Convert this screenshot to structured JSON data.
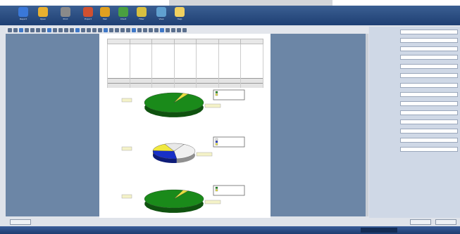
{
  "app": {
    "toolbar_buttons": [
      {
        "label": "Report",
        "icon": "globe-icon",
        "color": "#3a78d8"
      },
      {
        "label": "Open",
        "icon": "open-icon",
        "color": "#e8b030"
      },
      {
        "label": "Print",
        "icon": "printer-icon",
        "color": "#8a8a8a"
      },
      {
        "label": "Export",
        "icon": "export-icon",
        "color": "#d05030"
      },
      {
        "label": "Mail",
        "icon": "mail-icon",
        "color": "#e0a020"
      },
      {
        "label": "Chart",
        "icon": "chart-icon",
        "color": "#4aa040"
      },
      {
        "label": "Filter",
        "icon": "filter-icon",
        "color": "#d8c040"
      },
      {
        "label": "View",
        "icon": "view-icon",
        "color": "#60a0d0"
      },
      {
        "label": "Help",
        "icon": "help-icon",
        "color": "#f0d060"
      }
    ]
  },
  "report": {
    "title": "",
    "table": {
      "headers": [
        "",
        "",
        "",
        "",
        "",
        "",
        ""
      ],
      "rows": [
        [
          "",
          "",
          "",
          "",
          "",
          "",
          ""
        ],
        [
          "",
          "",
          "",
          "",
          "",
          "",
          ""
        ],
        [
          "",
          "",
          "",
          "",
          "",
          "",
          ""
        ],
        [
          "",
          "",
          "",
          "",
          "",
          "",
          ""
        ],
        [
          "",
          "",
          "",
          "",
          "",
          "",
          ""
        ],
        [
          "",
          "",
          "",
          "",
          "",
          "",
          ""
        ],
        [
          "",
          "",
          "",
          "",
          "",
          "",
          ""
        ],
        [
          "",
          "",
          "",
          "",
          "",
          "",
          ""
        ]
      ],
      "totals": [
        [
          "",
          "",
          "",
          "",
          "",
          "",
          ""
        ],
        [
          "",
          "",
          "",
          "",
          "",
          "",
          ""
        ]
      ]
    },
    "charts": [
      {
        "label": "",
        "slices": [
          {
            "share": 0.97,
            "color": "#1a8a1a"
          },
          {
            "share": 0.03,
            "color": "#e8e040"
          }
        ]
      },
      {
        "label": "",
        "slices": [
          {
            "share": 0.4,
            "color": "#f0f0f0"
          },
          {
            "share": 0.28,
            "color": "#1830c8"
          },
          {
            "share": 0.17,
            "color": "#f0e840"
          },
          {
            "share": 0.15,
            "color": "#e8e8e8"
          }
        ]
      },
      {
        "label": "",
        "slices": [
          {
            "share": 0.97,
            "color": "#1a8a1a"
          },
          {
            "share": 0.03,
            "color": "#e8e040"
          }
        ]
      }
    ]
  },
  "properties": {
    "rows": [
      {
        "label": "",
        "value": ""
      },
      {
        "label": "",
        "value": ""
      },
      {
        "label": "",
        "value": ""
      },
      {
        "label": "",
        "value": ""
      },
      {
        "label": "",
        "value": ""
      },
      {
        "label": "",
        "value": ""
      },
      {
        "label": "",
        "value": ""
      },
      {
        "label": "",
        "value": ""
      },
      {
        "label": "",
        "value": ""
      },
      {
        "label": "",
        "value": ""
      },
      {
        "label": "",
        "value": ""
      },
      {
        "label": "",
        "value": ""
      },
      {
        "label": "",
        "value": ""
      },
      {
        "label": "",
        "value": ""
      }
    ]
  },
  "statusbar": {
    "left_button": "",
    "right_buttons": [
      "",
      ""
    ]
  },
  "taskbar": {
    "items": [
      "",
      "",
      "",
      "",
      "",
      "",
      "",
      "",
      "",
      ""
    ]
  }
}
